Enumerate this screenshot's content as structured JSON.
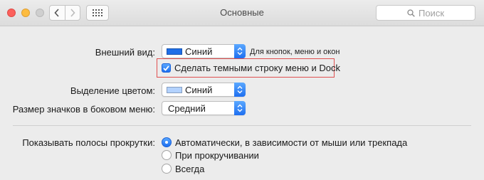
{
  "window": {
    "title": "Основные",
    "search_placeholder": "Поиск"
  },
  "icons": {
    "back": "chevron-left-icon",
    "forward": "chevron-right-icon",
    "show_all": "grid-icon",
    "search": "search-icon"
  },
  "appearance": {
    "label": "Внешний вид:",
    "value": "Синий",
    "swatch_color": "#1f6fe8",
    "hint": "Для кнопок, меню и окон"
  },
  "dark_menu": {
    "label": "Сделать темными строку меню и Dock",
    "checked": true
  },
  "highlight_color": {
    "label": "Выделение цветом:",
    "value": "Синий",
    "swatch_color": "#b3d2ff"
  },
  "sidebar_icon_size": {
    "label": "Размер значков в боковом меню:",
    "value": "Средний"
  },
  "scrollbars": {
    "label": "Показывать полосы прокрутки:",
    "options": [
      {
        "label": "Автоматически, в зависимости от мыши или трекпада",
        "selected": true
      },
      {
        "label": "При прокручивании",
        "selected": false
      },
      {
        "label": "Всегда",
        "selected": false
      }
    ]
  },
  "colors": {
    "accent": "#1e6ff0",
    "highlight_border": "#e05050"
  }
}
